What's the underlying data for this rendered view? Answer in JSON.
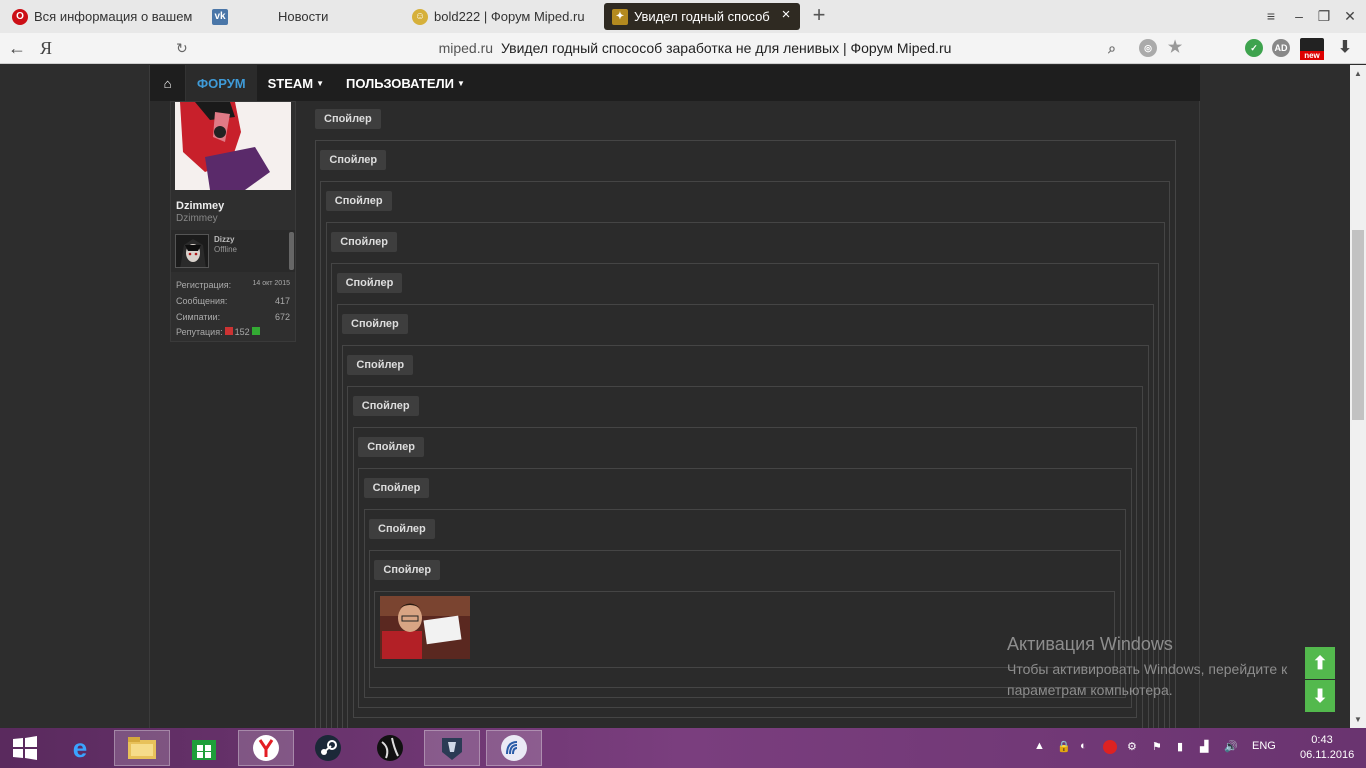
{
  "browser": {
    "tabs": [
      {
        "label": "Вся информация о вашем н",
        "icon": "opera-icon",
        "active": false
      },
      {
        "label": "Новости",
        "icon": "vk-icon",
        "active": false
      },
      {
        "label": "bold222 | Форум Miped.ru",
        "icon": "user-avatar-icon",
        "active": false
      },
      {
        "label": "Увидел годный способ",
        "icon": "fire-icon",
        "active": true
      }
    ],
    "address": {
      "host": "miped.ru",
      "title": "Увидел годный спосособ заработка не для ленивых | Форум Miped.ru"
    },
    "extensions": [
      "shield-icon",
      "adguard-icon",
      "new-mail-icon"
    ],
    "new_label": "new"
  },
  "site": {
    "nav": {
      "forum": "ФОРУМ",
      "steam": "STEAM",
      "users": "ПОЛЬЗОВАТЕЛИ"
    },
    "user": {
      "name": "Dzimmey",
      "title": "Dzimmey",
      "mini_name": "Dizzy",
      "mini_status": "Offline",
      "stats": {
        "reg_label": "Регистрация:",
        "reg_value": "14 окт 2015",
        "msg_label": "Сообщения:",
        "msg_value": "417",
        "likes_label": "Симпатии:",
        "likes_value": "672",
        "rep_label": "Репутация:",
        "rep_value": "152"
      }
    },
    "spoiler_label": "Спойлер",
    "spoiler_count": 12
  },
  "watermark": {
    "title": "Активация Windows",
    "text": "Чтобы активировать Windows, перейдите к параметрам компьютера."
  },
  "taskbar": {
    "lang": "ENG",
    "time": "0:43",
    "date": "06.11.2016"
  }
}
